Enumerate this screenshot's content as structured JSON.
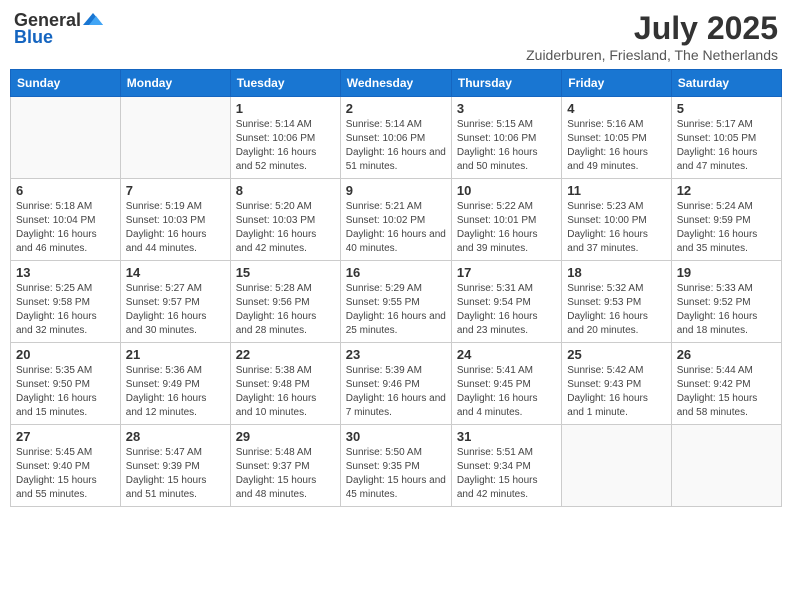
{
  "logo": {
    "general": "General",
    "blue": "Blue"
  },
  "title": "July 2025",
  "location": "Zuiderburen, Friesland, The Netherlands",
  "days_of_week": [
    "Sunday",
    "Monday",
    "Tuesday",
    "Wednesday",
    "Thursday",
    "Friday",
    "Saturday"
  ],
  "weeks": [
    [
      {
        "day": "",
        "info": ""
      },
      {
        "day": "",
        "info": ""
      },
      {
        "day": "1",
        "info": "Sunrise: 5:14 AM\nSunset: 10:06 PM\nDaylight: 16 hours and 52 minutes."
      },
      {
        "day": "2",
        "info": "Sunrise: 5:14 AM\nSunset: 10:06 PM\nDaylight: 16 hours and 51 minutes."
      },
      {
        "day": "3",
        "info": "Sunrise: 5:15 AM\nSunset: 10:06 PM\nDaylight: 16 hours and 50 minutes."
      },
      {
        "day": "4",
        "info": "Sunrise: 5:16 AM\nSunset: 10:05 PM\nDaylight: 16 hours and 49 minutes."
      },
      {
        "day": "5",
        "info": "Sunrise: 5:17 AM\nSunset: 10:05 PM\nDaylight: 16 hours and 47 minutes."
      }
    ],
    [
      {
        "day": "6",
        "info": "Sunrise: 5:18 AM\nSunset: 10:04 PM\nDaylight: 16 hours and 46 minutes."
      },
      {
        "day": "7",
        "info": "Sunrise: 5:19 AM\nSunset: 10:03 PM\nDaylight: 16 hours and 44 minutes."
      },
      {
        "day": "8",
        "info": "Sunrise: 5:20 AM\nSunset: 10:03 PM\nDaylight: 16 hours and 42 minutes."
      },
      {
        "day": "9",
        "info": "Sunrise: 5:21 AM\nSunset: 10:02 PM\nDaylight: 16 hours and 40 minutes."
      },
      {
        "day": "10",
        "info": "Sunrise: 5:22 AM\nSunset: 10:01 PM\nDaylight: 16 hours and 39 minutes."
      },
      {
        "day": "11",
        "info": "Sunrise: 5:23 AM\nSunset: 10:00 PM\nDaylight: 16 hours and 37 minutes."
      },
      {
        "day": "12",
        "info": "Sunrise: 5:24 AM\nSunset: 9:59 PM\nDaylight: 16 hours and 35 minutes."
      }
    ],
    [
      {
        "day": "13",
        "info": "Sunrise: 5:25 AM\nSunset: 9:58 PM\nDaylight: 16 hours and 32 minutes."
      },
      {
        "day": "14",
        "info": "Sunrise: 5:27 AM\nSunset: 9:57 PM\nDaylight: 16 hours and 30 minutes."
      },
      {
        "day": "15",
        "info": "Sunrise: 5:28 AM\nSunset: 9:56 PM\nDaylight: 16 hours and 28 minutes."
      },
      {
        "day": "16",
        "info": "Sunrise: 5:29 AM\nSunset: 9:55 PM\nDaylight: 16 hours and 25 minutes."
      },
      {
        "day": "17",
        "info": "Sunrise: 5:31 AM\nSunset: 9:54 PM\nDaylight: 16 hours and 23 minutes."
      },
      {
        "day": "18",
        "info": "Sunrise: 5:32 AM\nSunset: 9:53 PM\nDaylight: 16 hours and 20 minutes."
      },
      {
        "day": "19",
        "info": "Sunrise: 5:33 AM\nSunset: 9:52 PM\nDaylight: 16 hours and 18 minutes."
      }
    ],
    [
      {
        "day": "20",
        "info": "Sunrise: 5:35 AM\nSunset: 9:50 PM\nDaylight: 16 hours and 15 minutes."
      },
      {
        "day": "21",
        "info": "Sunrise: 5:36 AM\nSunset: 9:49 PM\nDaylight: 16 hours and 12 minutes."
      },
      {
        "day": "22",
        "info": "Sunrise: 5:38 AM\nSunset: 9:48 PM\nDaylight: 16 hours and 10 minutes."
      },
      {
        "day": "23",
        "info": "Sunrise: 5:39 AM\nSunset: 9:46 PM\nDaylight: 16 hours and 7 minutes."
      },
      {
        "day": "24",
        "info": "Sunrise: 5:41 AM\nSunset: 9:45 PM\nDaylight: 16 hours and 4 minutes."
      },
      {
        "day": "25",
        "info": "Sunrise: 5:42 AM\nSunset: 9:43 PM\nDaylight: 16 hours and 1 minute."
      },
      {
        "day": "26",
        "info": "Sunrise: 5:44 AM\nSunset: 9:42 PM\nDaylight: 15 hours and 58 minutes."
      }
    ],
    [
      {
        "day": "27",
        "info": "Sunrise: 5:45 AM\nSunset: 9:40 PM\nDaylight: 15 hours and 55 minutes."
      },
      {
        "day": "28",
        "info": "Sunrise: 5:47 AM\nSunset: 9:39 PM\nDaylight: 15 hours and 51 minutes."
      },
      {
        "day": "29",
        "info": "Sunrise: 5:48 AM\nSunset: 9:37 PM\nDaylight: 15 hours and 48 minutes."
      },
      {
        "day": "30",
        "info": "Sunrise: 5:50 AM\nSunset: 9:35 PM\nDaylight: 15 hours and 45 minutes."
      },
      {
        "day": "31",
        "info": "Sunrise: 5:51 AM\nSunset: 9:34 PM\nDaylight: 15 hours and 42 minutes."
      },
      {
        "day": "",
        "info": ""
      },
      {
        "day": "",
        "info": ""
      }
    ]
  ]
}
